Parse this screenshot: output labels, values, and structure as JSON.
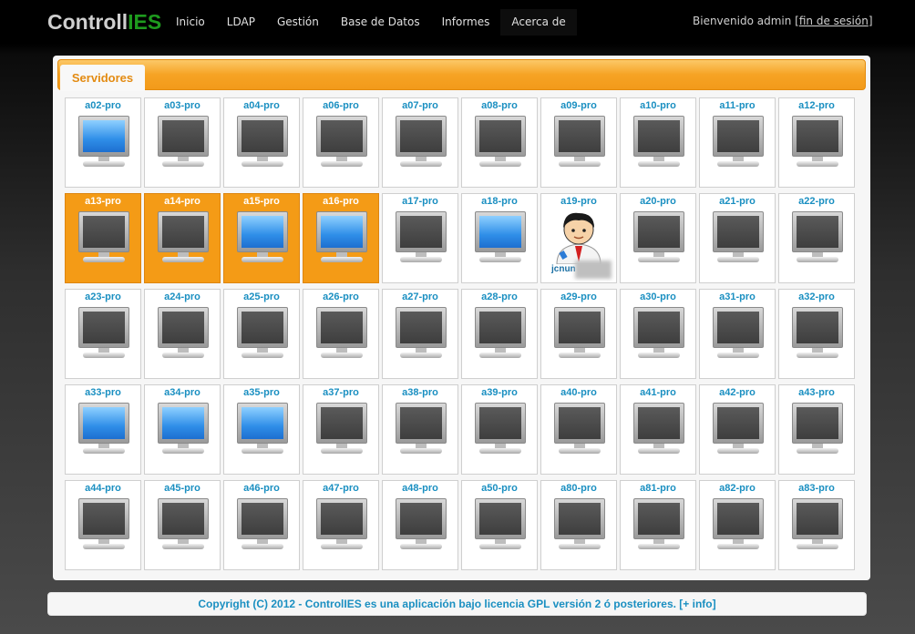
{
  "header": {
    "logo_part1": "Controll",
    "logo_part2": "IES",
    "nav": [
      "Inicio",
      "LDAP",
      "Gestión",
      "Base de Datos",
      "Informes",
      "Acerca de"
    ],
    "welcome_text": "Bienvenido admin [",
    "logout_link": "fin de sesión",
    "welcome_close": "]"
  },
  "tab": {
    "label": "Servidores"
  },
  "hosts": [
    {
      "name": "a02-pro",
      "state": "on",
      "selected": false
    },
    {
      "name": "a03-pro",
      "state": "off",
      "selected": false
    },
    {
      "name": "a04-pro",
      "state": "off",
      "selected": false
    },
    {
      "name": "a06-pro",
      "state": "off",
      "selected": false
    },
    {
      "name": "a07-pro",
      "state": "off",
      "selected": false
    },
    {
      "name": "a08-pro",
      "state": "off",
      "selected": false
    },
    {
      "name": "a09-pro",
      "state": "off",
      "selected": false
    },
    {
      "name": "a10-pro",
      "state": "off",
      "selected": false
    },
    {
      "name": "a11-pro",
      "state": "off",
      "selected": false
    },
    {
      "name": "a12-pro",
      "state": "off",
      "selected": false
    },
    {
      "name": "a13-pro",
      "state": "off",
      "selected": true
    },
    {
      "name": "a14-pro",
      "state": "off",
      "selected": true
    },
    {
      "name": "a15-pro",
      "state": "on",
      "selected": true
    },
    {
      "name": "a16-pro",
      "state": "on",
      "selected": true
    },
    {
      "name": "a17-pro",
      "state": "off",
      "selected": false
    },
    {
      "name": "a18-pro",
      "state": "on",
      "selected": false
    },
    {
      "name": "a19-pro",
      "state": "user",
      "selected": false,
      "user": "jcnun"
    },
    {
      "name": "a20-pro",
      "state": "off",
      "selected": false
    },
    {
      "name": "a21-pro",
      "state": "off",
      "selected": false
    },
    {
      "name": "a22-pro",
      "state": "off",
      "selected": false
    },
    {
      "name": "a23-pro",
      "state": "off",
      "selected": false
    },
    {
      "name": "a24-pro",
      "state": "off",
      "selected": false
    },
    {
      "name": "a25-pro",
      "state": "off",
      "selected": false
    },
    {
      "name": "a26-pro",
      "state": "off",
      "selected": false
    },
    {
      "name": "a27-pro",
      "state": "off",
      "selected": false
    },
    {
      "name": "a28-pro",
      "state": "off",
      "selected": false
    },
    {
      "name": "a29-pro",
      "state": "off",
      "selected": false
    },
    {
      "name": "a30-pro",
      "state": "off",
      "selected": false
    },
    {
      "name": "a31-pro",
      "state": "off",
      "selected": false
    },
    {
      "name": "a32-pro",
      "state": "off",
      "selected": false
    },
    {
      "name": "a33-pro",
      "state": "on",
      "selected": false
    },
    {
      "name": "a34-pro",
      "state": "on",
      "selected": false
    },
    {
      "name": "a35-pro",
      "state": "on",
      "selected": false
    },
    {
      "name": "a37-pro",
      "state": "off",
      "selected": false
    },
    {
      "name": "a38-pro",
      "state": "off",
      "selected": false
    },
    {
      "name": "a39-pro",
      "state": "off",
      "selected": false
    },
    {
      "name": "a40-pro",
      "state": "off",
      "selected": false
    },
    {
      "name": "a41-pro",
      "state": "off",
      "selected": false
    },
    {
      "name": "a42-pro",
      "state": "off",
      "selected": false
    },
    {
      "name": "a43-pro",
      "state": "off",
      "selected": false
    },
    {
      "name": "a44-pro",
      "state": "off",
      "selected": false
    },
    {
      "name": "a45-pro",
      "state": "off",
      "selected": false
    },
    {
      "name": "a46-pro",
      "state": "off",
      "selected": false
    },
    {
      "name": "a47-pro",
      "state": "off",
      "selected": false
    },
    {
      "name": "a48-pro",
      "state": "off",
      "selected": false
    },
    {
      "name": "a50-pro",
      "state": "off",
      "selected": false
    },
    {
      "name": "a80-pro",
      "state": "off",
      "selected": false
    },
    {
      "name": "a81-pro",
      "state": "off",
      "selected": false
    },
    {
      "name": "a82-pro",
      "state": "off",
      "selected": false
    },
    {
      "name": "a83-pro",
      "state": "off",
      "selected": false
    }
  ],
  "footer": {
    "text": "Copyright (C) 2012 - ControlIES es una aplicación bajo licencia GPL versión 2 ó posteriores. ",
    "link": "[+ info]"
  }
}
